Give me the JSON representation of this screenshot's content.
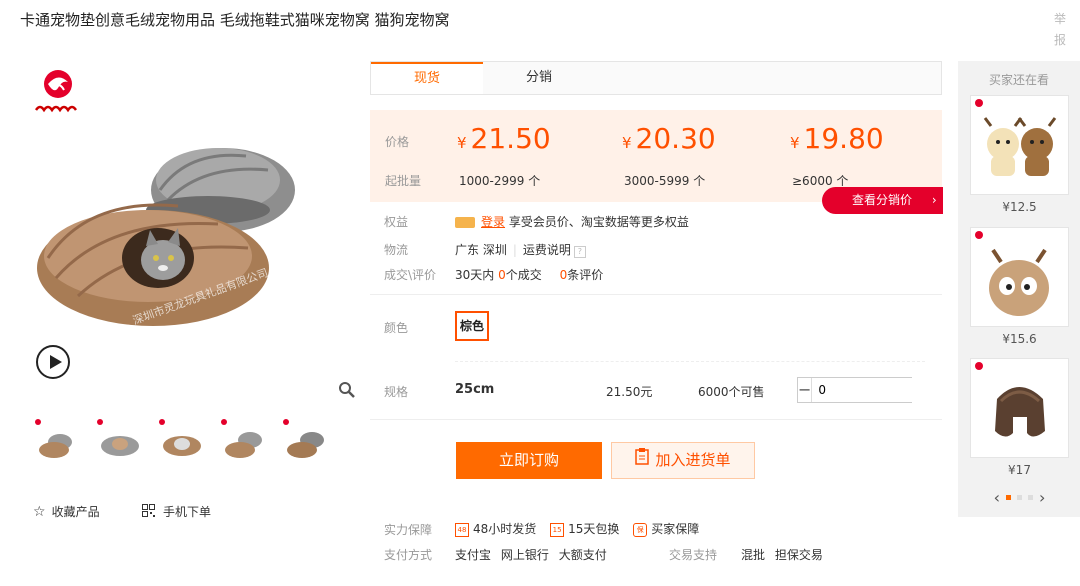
{
  "product": {
    "title": "卡通宠物垫创意毛绒宠物用品 毛绒拖鞋式猫咪宠物窝 猫狗宠物窝",
    "report": "举报",
    "watermark": "深圳市灵龙玩具礼品有限公司"
  },
  "left": {
    "favorite_label": "收藏产品",
    "mobile_label": "手机下单",
    "thumb_count": 5
  },
  "tabs": [
    {
      "label": "现货",
      "active": true
    },
    {
      "label": "分销",
      "active": false
    }
  ],
  "price": {
    "label": "价格",
    "moq_label": "起批量",
    "currency": "¥",
    "tiers": [
      {
        "price": "21.50",
        "qty": "1000-2999 个"
      },
      {
        "price": "20.30",
        "qty": "3000-5999 个"
      },
      {
        "price": "19.80",
        "qty": "≥6000 个"
      }
    ],
    "distributor_button": "查看分销价",
    "distributor_arrow": "›"
  },
  "info": {
    "rights_label": "权益",
    "login_link": "登录",
    "rights_text": "享受会员价、淘宝数据等更多权益",
    "logistics_label": "物流",
    "logistics_location": "广东 深圳",
    "shipping_desc": "运费说明",
    "deals_label": "成交\\评价",
    "deals_prefix": "30天内",
    "deals_count": "0",
    "deals_suffix": "个成交",
    "reviews_count": "0",
    "reviews_suffix": "条评价"
  },
  "color": {
    "label": "颜色",
    "selected": "棕色"
  },
  "spec": {
    "label": "规格",
    "size": "25cm",
    "unit_price": "21.50元",
    "stock": "6000个可售",
    "quantity": "0",
    "minus": "−",
    "plus": "+"
  },
  "actions": {
    "buy": "立即订购",
    "cart": "加入进货单"
  },
  "guarantee": {
    "label": "实力保障",
    "items": [
      {
        "badge": "48",
        "text": "48小时发货"
      },
      {
        "badge": "15",
        "text": "15天包换"
      },
      {
        "badge": "保",
        "text": "买家保障"
      }
    ],
    "pay_label": "支付方式",
    "pay_methods": [
      "支付宝",
      "网上银行",
      "大额支付"
    ],
    "trade_label": "交易支持",
    "trade_items": [
      "混批",
      "担保交易"
    ]
  },
  "side": {
    "title": "买家还在看",
    "items": [
      {
        "price": "¥12.5"
      },
      {
        "price": "¥15.6"
      },
      {
        "price": "¥17"
      }
    ],
    "prev": "‹",
    "next": "›"
  },
  "colors": {
    "accent": "#ff6a00",
    "price": "#ff5000",
    "red_button": "#e4002b",
    "price_bg": "#fff1e8"
  }
}
